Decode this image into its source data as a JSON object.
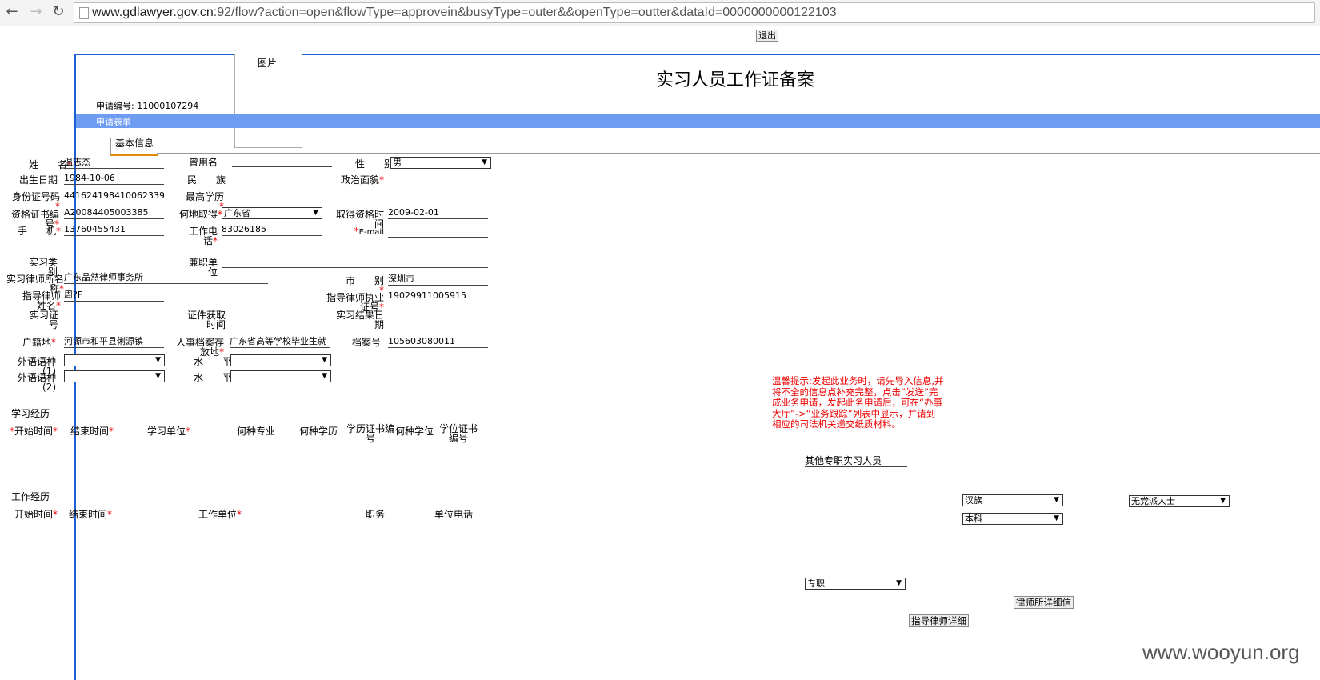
{
  "browser": {
    "url_host": "www.gdlawyer.gov.cn",
    "url_rest": ":92/flow?action=open&flowType=approvein&busyType=outer&&openType=outter&dataId=0000000000122103"
  },
  "toolbar": {
    "exit_label": "退出"
  },
  "page": {
    "photo_label": "图片",
    "title": "实习人员工作证备案",
    "app_no_label": "申请编号:",
    "app_no": "11000107294",
    "section_band": "申请表单",
    "tab_basic": "基本信息"
  },
  "form": {
    "name_label": "姓　　名",
    "name_value": "温志杰",
    "former_name_label": "曾用名",
    "gender_label": "性　　别",
    "gender_value": "男",
    "birth_label": "出生日期",
    "birth_value": "1984-10-06",
    "ethnic_label": "民　　族",
    "political_label": "政治面貌",
    "id_label": "身份证号码",
    "id_value": "441624198410062339",
    "education_label": "最高学历",
    "cert_no_label": "资格证书编号",
    "cert_no_value": "A20084405003385",
    "where_label": "何地取得",
    "where_value": "广东省",
    "cert_time_label": "取得资格时间",
    "cert_time_value": "2009-02-01",
    "mobile_label": "手　　机",
    "mobile_value": "13760455431",
    "work_phone_label": "工作电话",
    "work_phone_value": "83026185",
    "email_label": "E-mail",
    "intern_type_label": "实习类别",
    "part_time_label": "兼职单位",
    "firm_label": "实习律师所名称",
    "firm_value": "广东品然律师事务所",
    "city_label": "市　　别",
    "city_value": "深圳市",
    "mentor_label": "指导律师姓名",
    "mentor_value": "周?F",
    "mentor_license_label": "指导律师执业证号",
    "mentor_license_value": "19029911005915",
    "intern_cert_label": "实习证号",
    "cert_get_time_label": "证件获取时间",
    "intern_end_label": "实习结果日期",
    "hukou_label": "户籍地",
    "hukou_value": "河源市和平县俐源镇",
    "archive_label": "人事档案存放地",
    "archive_value": "广东省高等学校毕业生就",
    "archive_no_label": "档案号",
    "archive_no_value": "105603080011",
    "lang1_label": "外语语种(1)",
    "lang2_label": "外语语种(2)",
    "level_label": "水　　平"
  },
  "study": {
    "section_label": "学习经历",
    "headers": [
      "开始时间",
      "结束时间",
      "学习单位",
      "何种专业",
      "何种学历",
      "学历证书编号",
      "何种学位",
      "学位证书编号"
    ]
  },
  "work": {
    "section_label": "工作经历",
    "headers": [
      "开始时间",
      "结束时间",
      "工作单位",
      "职务",
      "单位电话"
    ]
  },
  "hint": "温馨提示:发起此业务时，请先导入信息,并将不全的信息点补充完整，点击“发送”完成业务申请，发起此务申请后，可在“办事大厅”->“业务跟踪”列表中显示，并请到相应的司法机关递交纸质材料。",
  "extra": {
    "other_intern": "其他专职实习人员",
    "ethnic_select": "汉族",
    "political_select": "无党派人士",
    "education_select": "本科",
    "fulltime_select": "专职",
    "firm_detail_btn": "律师所详细信",
    "mentor_detail_btn": "指导律师详细"
  },
  "watermark": "www.wooyun.org"
}
